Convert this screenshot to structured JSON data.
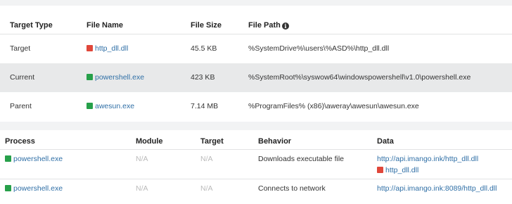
{
  "targets_table": {
    "headers": {
      "target_type": "Target Type",
      "file_name": "File Name",
      "file_size": "File Size",
      "file_path": "File Path"
    },
    "rows": [
      {
        "type": "Target",
        "file": "http_dll.dll",
        "file_status": "red",
        "size": "45.5 KB",
        "path": "%SystemDrive%\\users\\%ASD%\\http_dll.dll"
      },
      {
        "type": "Current",
        "file": "powershell.exe",
        "file_status": "green",
        "size": "423 KB",
        "path": "%SystemRoot%\\syswow64\\windowspowershell\\v1.0\\powershell.exe"
      },
      {
        "type": "Parent",
        "file": "awesun.exe",
        "file_status": "green",
        "size": "7.14 MB",
        "path": "%ProgramFiles% (x86)\\aweray\\awesun\\awesun.exe"
      }
    ]
  },
  "behavior_table": {
    "headers": {
      "process": "Process",
      "module": "Module",
      "target": "Target",
      "behavior": "Behavior",
      "data": "Data"
    },
    "rows": [
      {
        "process": "powershell.exe",
        "process_status": "green",
        "module": "N/A",
        "target": "N/A",
        "behavior": "Downloads executable file",
        "data_url": "http://api.imango.ink/http_dll.dll",
        "data_file": "http_dll.dll",
        "data_file_status": "red"
      },
      {
        "process": "powershell.exe",
        "process_status": "green",
        "module": "N/A",
        "target": "N/A",
        "behavior": "Connects to network",
        "data_url": "http://api.imango.ink:8089/http_dll.dll"
      }
    ]
  },
  "colors": {
    "link": "#2f6fa6",
    "status_red": "#e0473a",
    "status_green": "#27a04a",
    "row_shade": "#e8e9ea"
  },
  "icons": {
    "file_path_info": "info-icon",
    "status_square": "square-icon"
  }
}
